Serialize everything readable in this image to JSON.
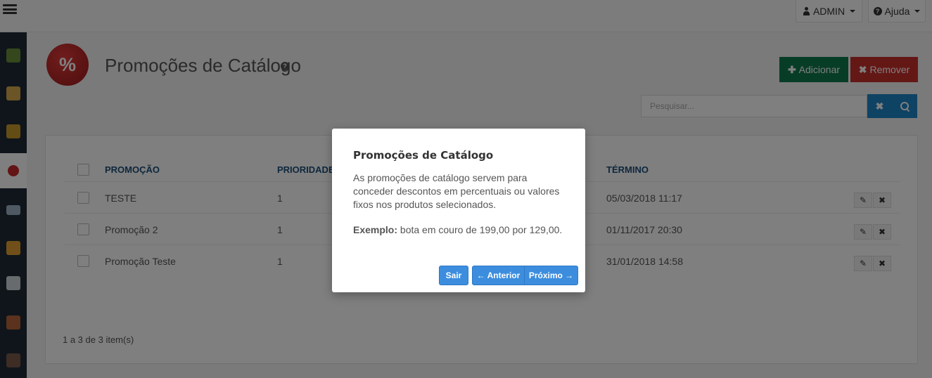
{
  "topbar": {
    "user_label": "ADMIN",
    "help_label": "Ajuda"
  },
  "sidebar": {
    "items": [
      {
        "icon": "box-icon",
        "color": "#6b8e3a"
      },
      {
        "icon": "package-icon",
        "color": "#d7a84c"
      },
      {
        "icon": "products-icon",
        "color": "#c89a2a"
      },
      {
        "icon": "promotion-icon",
        "color": "#c62828",
        "active": true
      },
      {
        "icon": "card-icon",
        "color": "#9fb3c8"
      },
      {
        "icon": "truck-icon",
        "color": "#e0a030"
      },
      {
        "icon": "document-icon",
        "color": "#cfd6dd"
      },
      {
        "icon": "users-icon",
        "color": "#b5653c"
      },
      {
        "icon": "user-icon",
        "color": "#7a5a4a"
      }
    ]
  },
  "header": {
    "badge": "%",
    "title": "Promoções de Catálogo",
    "add_label": "Adicionar",
    "remove_label": "Remover"
  },
  "search": {
    "placeholder": "Pesquisar..."
  },
  "table": {
    "columns": [
      "PROMOÇÃO",
      "PRIORIDADE",
      "TÉRMINO"
    ],
    "rows": [
      {
        "name": "TESTE",
        "priority": "1",
        "end": "05/03/2018 11:17"
      },
      {
        "name": "Promoção 2",
        "priority": "1",
        "end": "01/11/2017 20:30"
      },
      {
        "name": "Promoção Teste",
        "priority": "1",
        "end": "31/01/2018 14:58"
      }
    ],
    "pager": "1 a 3 de 3 item(s)"
  },
  "modal": {
    "title": "Promoções de Catálogo",
    "body": "As promoções de catálogo servem para conceder descontos em percentuais ou valores fixos nos produtos selecionados.",
    "example_label": "Exemplo:",
    "example_text": " bota em couro de 199,00 por 129,00.",
    "exit_label": "Sair",
    "prev_label": "← Anterior",
    "next_label": "Próximo →"
  },
  "colors": {
    "accent": "#1f86c8",
    "add": "#0e7a4f",
    "remove": "#c9302c",
    "modal_button": "#3c8dde",
    "sidebar": "#1f2a36"
  }
}
